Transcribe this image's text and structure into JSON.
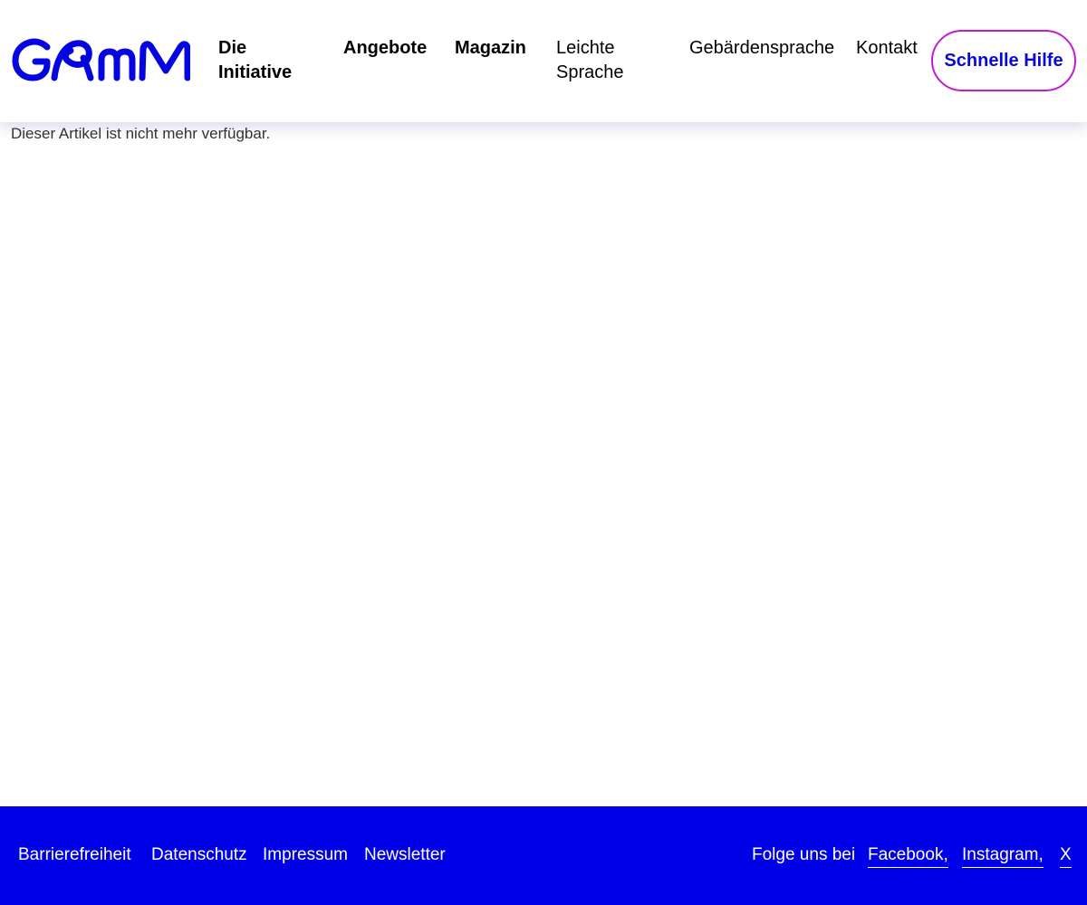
{
  "header": {
    "logo_text": "GAmM",
    "nav": [
      {
        "label": "Die Initiative"
      },
      {
        "label": "Angebote"
      },
      {
        "label": "Magazin"
      },
      {
        "label": "Leichte Sprache"
      },
      {
        "label": "Gebärdensprache"
      },
      {
        "label": "Kontakt"
      }
    ],
    "help_button": "Schnelle Hilfe"
  },
  "main": {
    "notice": "Dieser Artikel ist nicht mehr verfügbar."
  },
  "footer": {
    "links": [
      {
        "label": "Barrierefreiheit"
      },
      {
        "label": "Datenschutz"
      },
      {
        "label": "Impressum"
      },
      {
        "label": "Newsletter"
      }
    ],
    "follow_label": "Folge uns bei",
    "social": [
      {
        "label": "Facebook,"
      },
      {
        "label": "Instagram,"
      },
      {
        "label": "X"
      }
    ]
  },
  "colors": {
    "brand_blue": "#0000e6",
    "button_border": "#c21bd0",
    "button_text": "#0a0ad8"
  }
}
